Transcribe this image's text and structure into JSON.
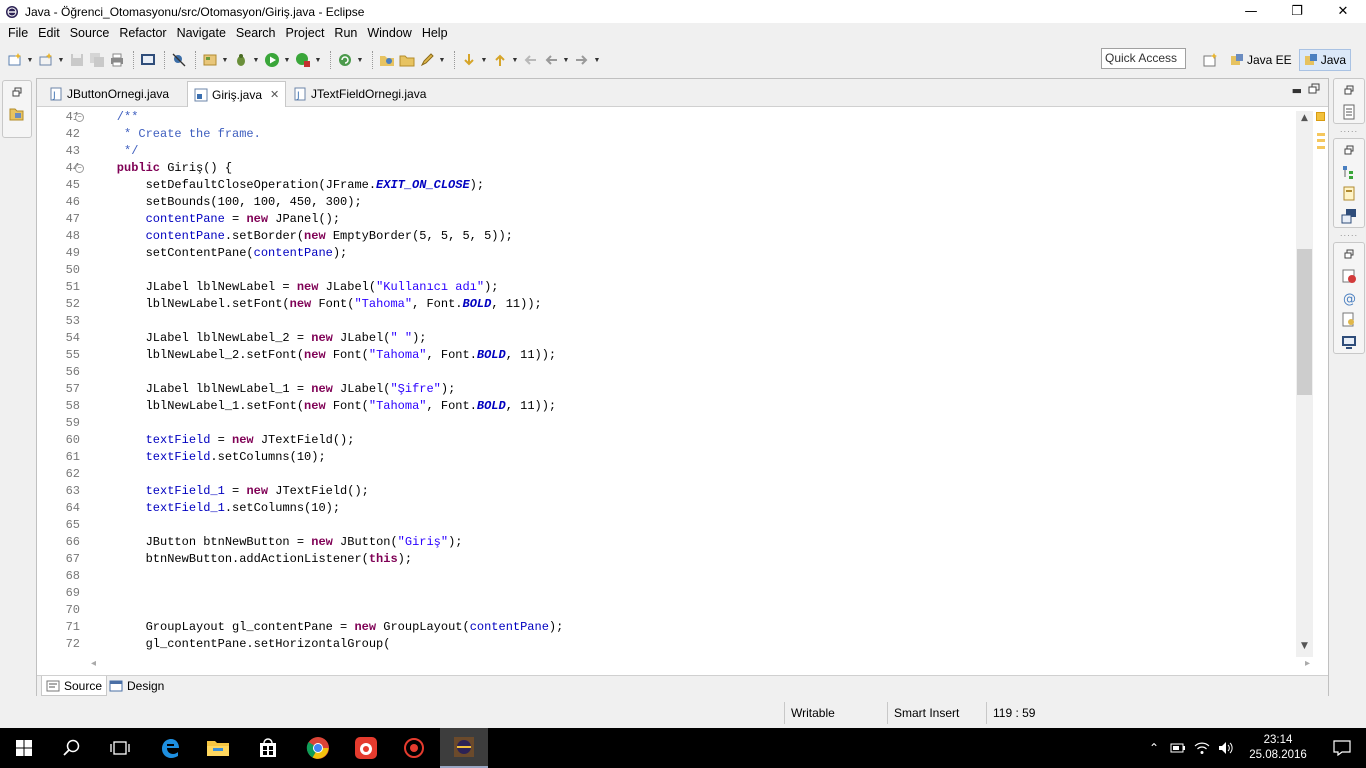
{
  "window": {
    "title": "Java - Öğrenci_Otomasyonu/src/Otomasyon/Giriş.java - Eclipse",
    "minimize_glyph": "—",
    "maximize_glyph": "❐",
    "close_glyph": "✕"
  },
  "menu": [
    "File",
    "Edit",
    "Source",
    "Refactor",
    "Navigate",
    "Search",
    "Project",
    "Run",
    "Window",
    "Help"
  ],
  "toolbar": {
    "quick_access_placeholder": "Quick Access",
    "perspectives": [
      {
        "label": "Java EE",
        "active": false
      },
      {
        "label": "Java",
        "active": true
      }
    ]
  },
  "editor": {
    "tabs": [
      {
        "label": "JButtonOrnegi.java",
        "active": false
      },
      {
        "label": "Giriş.java",
        "active": true,
        "close": "✕"
      },
      {
        "label": "JTextFieldOrnegi.java",
        "active": false
      }
    ],
    "minimize_glyph": "▬",
    "lines": [
      {
        "n": "41",
        "fold": true,
        "tokens": [
          [
            "cmt",
            "    /**"
          ]
        ]
      },
      {
        "n": "42",
        "tokens": [
          [
            "cmt",
            "     * Create the frame."
          ]
        ]
      },
      {
        "n": "43",
        "tokens": [
          [
            "cmt",
            "     */"
          ]
        ]
      },
      {
        "n": "44",
        "fold": true,
        "tokens": [
          [
            "kw",
            "    public"
          ],
          [
            "",
            " Giriş() {"
          ]
        ]
      },
      {
        "n": "45",
        "tokens": [
          [
            "",
            "        setDefaultCloseOperation(JFrame."
          ],
          [
            "sfld",
            "EXIT_ON_CLOSE"
          ],
          [
            "",
            ");"
          ]
        ]
      },
      {
        "n": "46",
        "tokens": [
          [
            "",
            "        setBounds(100, 100, 450, 300);"
          ]
        ]
      },
      {
        "n": "47",
        "tokens": [
          [
            "fld",
            "        contentPane"
          ],
          [
            "",
            " = "
          ],
          [
            "kw",
            "new"
          ],
          [
            "",
            " JPanel();"
          ]
        ]
      },
      {
        "n": "48",
        "tokens": [
          [
            "fld",
            "        contentPane"
          ],
          [
            "",
            ".setBorder("
          ],
          [
            "kw",
            "new"
          ],
          [
            "",
            " EmptyBorder(5, 5, 5, 5));"
          ]
        ]
      },
      {
        "n": "49",
        "tokens": [
          [
            "",
            "        setContentPane("
          ],
          [
            "fld",
            "contentPane"
          ],
          [
            "",
            ");"
          ]
        ]
      },
      {
        "n": "50",
        "tokens": [
          [
            "",
            ""
          ]
        ]
      },
      {
        "n": "51",
        "tokens": [
          [
            "",
            "        JLabel lblNewLabel = "
          ],
          [
            "kw",
            "new"
          ],
          [
            "",
            " JLabel("
          ],
          [
            "str",
            "\"Kullanıcı adı\""
          ],
          [
            "",
            ");"
          ]
        ]
      },
      {
        "n": "52",
        "tokens": [
          [
            "",
            "        lblNewLabel.setFont("
          ],
          [
            "kw",
            "new"
          ],
          [
            "",
            " Font("
          ],
          [
            "str",
            "\"Tahoma\""
          ],
          [
            "",
            ", Font."
          ],
          [
            "sfld",
            "BOLD"
          ],
          [
            "",
            ", 11));"
          ]
        ]
      },
      {
        "n": "53",
        "tokens": [
          [
            "",
            ""
          ]
        ]
      },
      {
        "n": "54",
        "tokens": [
          [
            "",
            "        JLabel lblNewLabel_2 = "
          ],
          [
            "kw",
            "new"
          ],
          [
            "",
            " JLabel("
          ],
          [
            "str",
            "\" \""
          ],
          [
            "",
            ");"
          ]
        ]
      },
      {
        "n": "55",
        "tokens": [
          [
            "",
            "        lblNewLabel_2.setFont("
          ],
          [
            "kw",
            "new"
          ],
          [
            "",
            " Font("
          ],
          [
            "str",
            "\"Tahoma\""
          ],
          [
            "",
            ", Font."
          ],
          [
            "sfld",
            "BOLD"
          ],
          [
            "",
            ", 11));"
          ]
        ]
      },
      {
        "n": "56",
        "tokens": [
          [
            "",
            ""
          ]
        ]
      },
      {
        "n": "57",
        "tokens": [
          [
            "",
            "        JLabel lblNewLabel_1 = "
          ],
          [
            "kw",
            "new"
          ],
          [
            "",
            " JLabel("
          ],
          [
            "str",
            "\"Şifre\""
          ],
          [
            "",
            ");"
          ]
        ]
      },
      {
        "n": "58",
        "tokens": [
          [
            "",
            "        lblNewLabel_1.setFont("
          ],
          [
            "kw",
            "new"
          ],
          [
            "",
            " Font("
          ],
          [
            "str",
            "\"Tahoma\""
          ],
          [
            "",
            ", Font."
          ],
          [
            "sfld",
            "BOLD"
          ],
          [
            "",
            ", 11));"
          ]
        ]
      },
      {
        "n": "59",
        "tokens": [
          [
            "",
            ""
          ]
        ]
      },
      {
        "n": "60",
        "tokens": [
          [
            "fld",
            "        textField"
          ],
          [
            "",
            " = "
          ],
          [
            "kw",
            "new"
          ],
          [
            "",
            " JTextField();"
          ]
        ]
      },
      {
        "n": "61",
        "tokens": [
          [
            "fld",
            "        textField"
          ],
          [
            "",
            ".setColumns(10);"
          ]
        ]
      },
      {
        "n": "62",
        "tokens": [
          [
            "",
            ""
          ]
        ]
      },
      {
        "n": "63",
        "tokens": [
          [
            "fld",
            "        textField_1"
          ],
          [
            "",
            " = "
          ],
          [
            "kw",
            "new"
          ],
          [
            "",
            " JTextField();"
          ]
        ]
      },
      {
        "n": "64",
        "tokens": [
          [
            "fld",
            "        textField_1"
          ],
          [
            "",
            ".setColumns(10);"
          ]
        ]
      },
      {
        "n": "65",
        "tokens": [
          [
            "",
            ""
          ]
        ]
      },
      {
        "n": "66",
        "tokens": [
          [
            "",
            "        JButton btnNewButton = "
          ],
          [
            "kw",
            "new"
          ],
          [
            "",
            " JButton("
          ],
          [
            "str",
            "\"Giriş\""
          ],
          [
            "",
            ");"
          ]
        ]
      },
      {
        "n": "67",
        "tokens": [
          [
            "",
            "        btnNewButton.addActionListener("
          ],
          [
            "kw",
            "this"
          ],
          [
            "",
            ");"
          ]
        ]
      },
      {
        "n": "68",
        "tokens": [
          [
            "",
            ""
          ]
        ]
      },
      {
        "n": "69",
        "tokens": [
          [
            "",
            ""
          ]
        ]
      },
      {
        "n": "70",
        "tokens": [
          [
            "",
            ""
          ]
        ]
      },
      {
        "n": "71",
        "tokens": [
          [
            "",
            "        GroupLayout gl_contentPane = "
          ],
          [
            "kw",
            "new"
          ],
          [
            "",
            " GroupLayout("
          ],
          [
            "fld",
            "contentPane"
          ],
          [
            "",
            ");"
          ]
        ]
      },
      {
        "n": "72",
        "tokens": [
          [
            "",
            "        gl_contentPane.setHorizontalGroup("
          ]
        ]
      }
    ],
    "bottom_tabs": [
      {
        "label": "Source",
        "active": true
      },
      {
        "label": "Design",
        "active": false
      }
    ]
  },
  "statusbar": {
    "writable": "Writable",
    "insert_mode": "Smart Insert",
    "position": "119 : 59"
  },
  "taskbar": {
    "time": "23:14",
    "date": "25.08.2016"
  },
  "colors": {
    "keyword": "#7f0055",
    "field": "#0000c0",
    "string": "#2a00ff",
    "comment": "#3f5fbf",
    "taskbar": "#000000",
    "active_perspective": "#dbe8f8"
  }
}
